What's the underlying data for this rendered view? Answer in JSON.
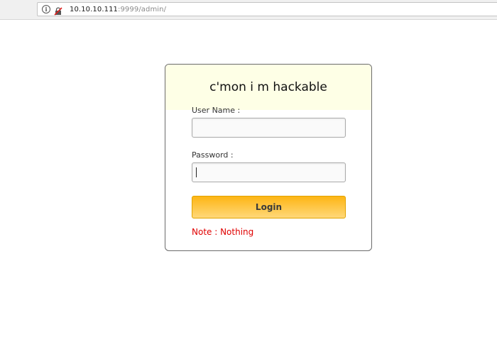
{
  "browser": {
    "url_host": "10.10.10.111",
    "url_path": ":9999/admin/",
    "info_icon": "info-icon",
    "insecure_icon": "insecure-lock-icon"
  },
  "login": {
    "title": "c'mon i m hackable",
    "username_label": "User Name :",
    "username_value": "",
    "password_label": "Password :",
    "password_value": "",
    "login_button": "Login",
    "note": "Note : Nothing"
  },
  "colors": {
    "header_bg": "#feffe6",
    "button_gradient_top": "#fdb514",
    "button_gradient_bottom": "#ffd87a",
    "note_color": "#e00000"
  }
}
